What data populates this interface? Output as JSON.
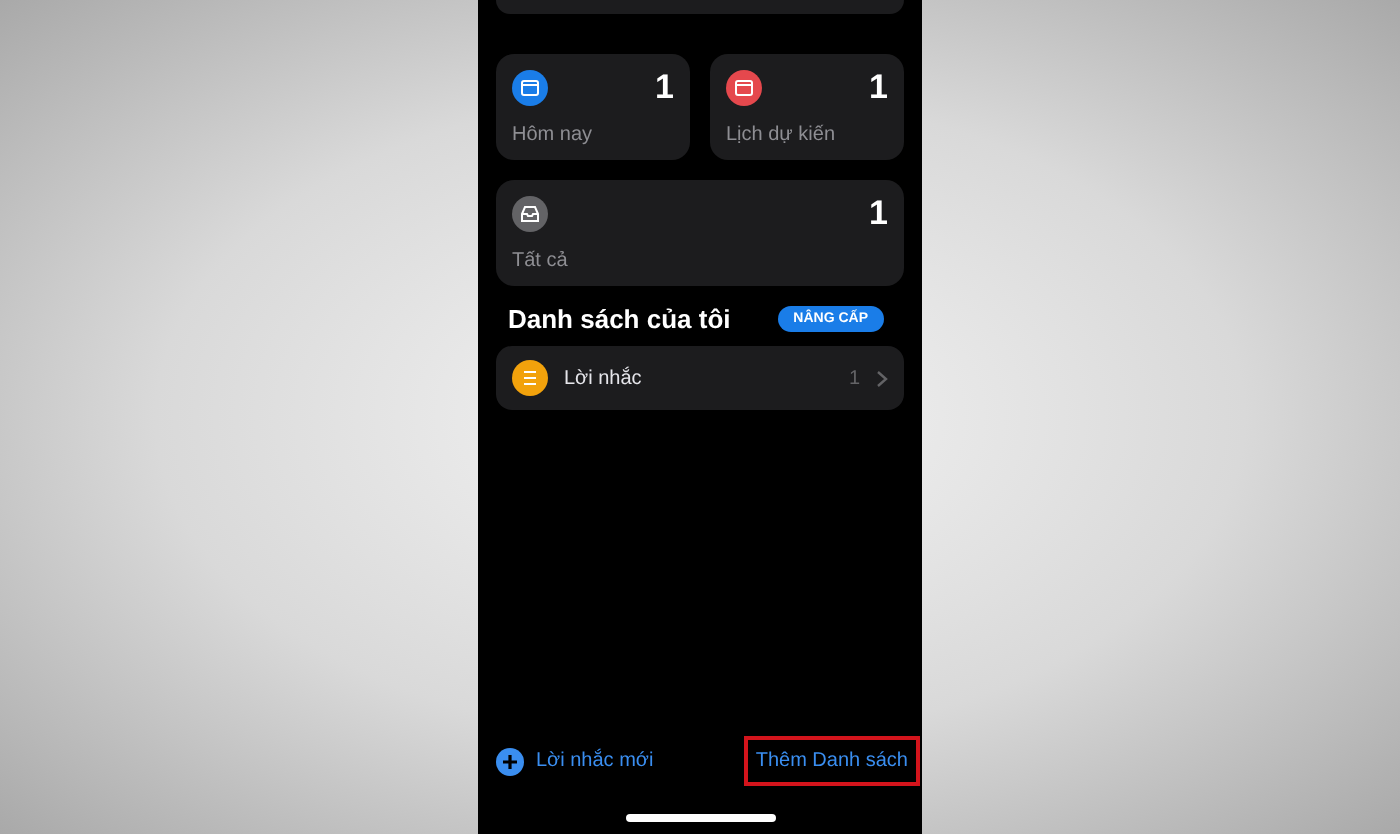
{
  "smart_lists": [
    {
      "kind": "today",
      "label": "Hôm nay",
      "count": "1",
      "color": "#1a7de8"
    },
    {
      "kind": "scheduled",
      "label": "Lịch dự kiến",
      "count": "1",
      "color": "#e5484d"
    },
    {
      "kind": "all",
      "label": "Tất cả",
      "count": "1",
      "color": "#636366"
    }
  ],
  "my_lists": {
    "title": "Danh sách của tôi",
    "upgrade_button": "NÂNG CẤP",
    "items": [
      {
        "name": "Lời nhắc",
        "count": "1",
        "color": "#f2a20c"
      }
    ]
  },
  "toolbar": {
    "new_reminder": "Lời nhắc mới",
    "add_list": "Thêm Danh sách",
    "add_list_highlighted": true
  }
}
